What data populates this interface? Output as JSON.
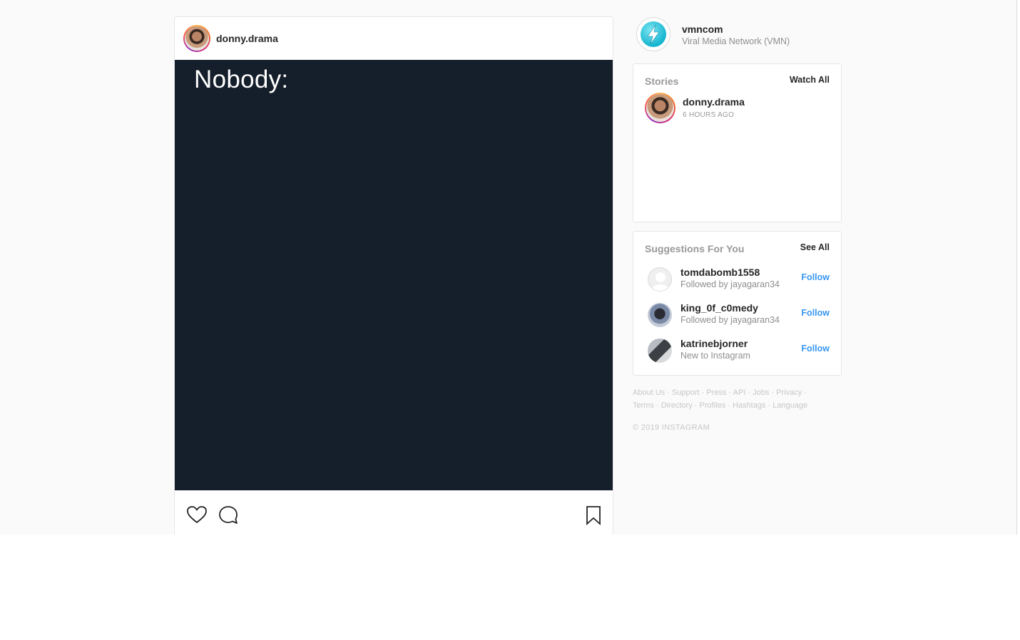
{
  "post": {
    "username": "donny.drama",
    "image_text": "Nobody:"
  },
  "profile": {
    "username": "vmncom",
    "full_name": "Viral Media Network (VMN)"
  },
  "stories": {
    "title": "Stories",
    "watch_all": "Watch All",
    "items": [
      {
        "username": "donny.drama",
        "time": "6 HOURS AGO"
      }
    ]
  },
  "suggestions": {
    "title": "Suggestions For You",
    "see_all": "See All",
    "follow_label": "Follow",
    "items": [
      {
        "username": "tomdabomb1558",
        "subtitle": "Followed by jayagaran34"
      },
      {
        "username": "king_0f_c0medy",
        "subtitle": "Followed by jayagaran34"
      },
      {
        "username": "katrinebjorner",
        "subtitle": "New to Instagram"
      }
    ]
  },
  "footer": {
    "links": [
      "About Us",
      "Support",
      "Press",
      "API",
      "Jobs",
      "Privacy",
      "Terms",
      "Directory",
      "Profiles",
      "Hashtags",
      "Language"
    ],
    "copyright": "© 2019 INSTAGRAM"
  },
  "icons": {
    "like": "heart-icon",
    "comment": "comment-icon",
    "save": "bookmark-icon",
    "brand": "lightning-bolt-icon"
  },
  "colors": {
    "link_blue": "#3897f0",
    "image_bg": "#151f2b",
    "vmn_cyan": "#14b4cf"
  }
}
